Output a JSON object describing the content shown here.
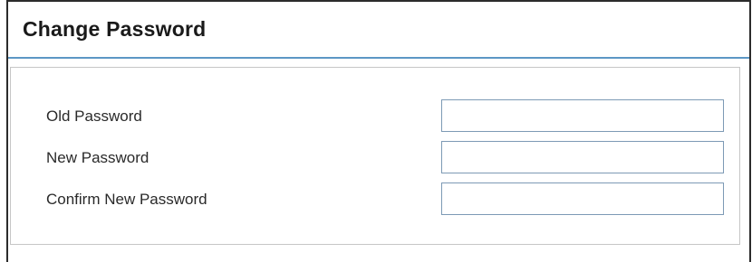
{
  "header": {
    "title": "Change Password"
  },
  "form": {
    "fields": [
      {
        "label": "Old Password",
        "value": "",
        "placeholder": ""
      },
      {
        "label": "New Password",
        "value": "",
        "placeholder": ""
      },
      {
        "label": "Confirm New Password",
        "value": "",
        "placeholder": ""
      }
    ]
  },
  "colors": {
    "accent_line": "#5c97c5",
    "input_border": "#7d9ab5",
    "panel_border": "#c6c6c6",
    "frame_border": "#2b2b2b"
  }
}
